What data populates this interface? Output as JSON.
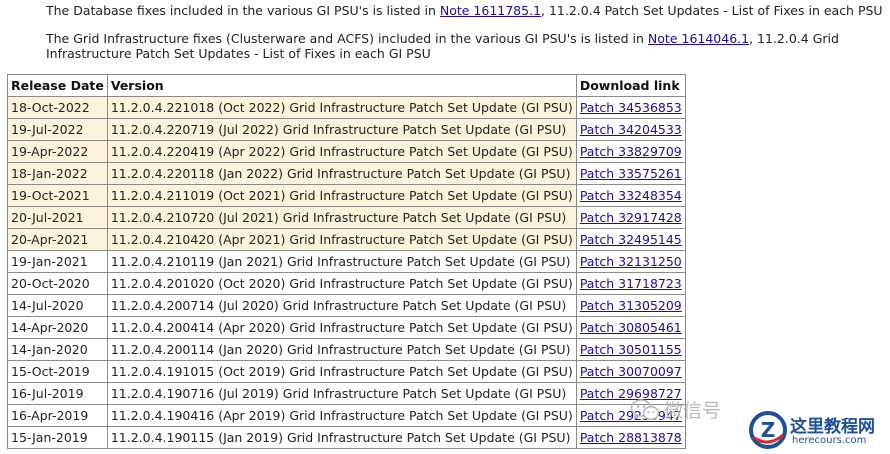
{
  "paragraphs": {
    "p1": {
      "prefix": "The Database fixes included in the various GI PSU's is listed in ",
      "link": "Note 1611785.1",
      "suffix": ", 11.2.0.4 Patch Set Updates - List of Fixes in each PSU"
    },
    "p2": {
      "prefix": "The Grid Infrastructure fixes (Clusterware and ACFS) included in the various GI PSU's is listed in ",
      "link": "Note 1614046.1",
      "suffix": ", 11.2.0.4 Grid Infrastructure Patch Set Updates - List of Fixes in each GI PSU"
    }
  },
  "table": {
    "headers": [
      "Release Date",
      "Version",
      "Download link"
    ],
    "highlight_color": "#fbf3da",
    "rows": [
      {
        "date": "18-Oct-2022",
        "version": "11.2.0.4.221018 (Oct 2022) Grid Infrastructure Patch Set Update (GI PSU)",
        "link": "Patch 34536853",
        "highlight": true
      },
      {
        "date": "19-Jul-2022",
        "version": "11.2.0.4.220719 (Jul 2022) Grid Infrastructure Patch Set Update (GI PSU)",
        "link": "Patch 34204533",
        "highlight": true
      },
      {
        "date": "19-Apr-2022",
        "version": "11.2.0.4.220419 (Apr 2022) Grid Infrastructure Patch Set Update (GI PSU)",
        "link": "Patch 33829709",
        "highlight": true
      },
      {
        "date": "18-Jan-2022",
        "version": "11.2.0.4.220118 (Jan 2022) Grid Infrastructure Patch Set Update (GI PSU)",
        "link": "Patch 33575261",
        "highlight": true
      },
      {
        "date": "19-Oct-2021",
        "version": "11.2.0.4.211019 (Oct 2021) Grid Infrastructure Patch Set Update (GI PSU)",
        "link": "Patch 33248354",
        "highlight": true
      },
      {
        "date": "20-Jul-2021",
        "version": "11.2.0.4.210720 (Jul 2021) Grid Infrastructure Patch Set Update (GI PSU)",
        "link": "Patch 32917428",
        "highlight": true
      },
      {
        "date": "20-Apr-2021",
        "version": "11.2.0.4.210420 (Apr 2021) Grid Infrastructure Patch Set Update (GI PSU)",
        "link": "Patch 32495145",
        "highlight": true
      },
      {
        "date": "19-Jan-2021",
        "version": "11.2.0.4.210119 (Jan 2021) Grid Infrastructure Patch Set Update (GI PSU)",
        "link": "Patch 32131250",
        "highlight": false
      },
      {
        "date": "20-Oct-2020",
        "version": "11.2.0.4.201020 (Oct 2020) Grid Infrastructure Patch Set Update (GI PSU)",
        "link": "Patch 31718723",
        "highlight": false
      },
      {
        "date": "14-Jul-2020",
        "version": "11.2.0.4.200714 (Jul 2020) Grid Infrastructure Patch Set Update (GI PSU)",
        "link": "Patch 31305209",
        "highlight": false
      },
      {
        "date": "14-Apr-2020",
        "version": "11.2.0.4.200414 (Apr 2020) Grid Infrastructure Patch Set Update (GI PSU)",
        "link": "Patch 30805461",
        "highlight": false
      },
      {
        "date": "14-Jan-2020",
        "version": "11.2.0.4.200114 (Jan 2020) Grid Infrastructure Patch Set Update (GI PSU)",
        "link": "Patch 30501155",
        "highlight": false
      },
      {
        "date": "15-Oct-2019",
        "version": "11.2.0.4.191015 (Oct 2019) Grid Infrastructure Patch Set Update (GI PSU)",
        "link": "Patch 30070097",
        "highlight": false
      },
      {
        "date": "16-Jul-2019",
        "version": "11.2.0.4.190716 (Jul 2019) Grid Infrastructure Patch Set Update (GI PSU)",
        "link": "Patch 29698727",
        "highlight": false
      },
      {
        "date": "16-Apr-2019",
        "version": "11.2.0.4.190416 (Apr 2019) Grid Infrastructure Patch Set Update (GI PSU)",
        "link": "Patch 29255947",
        "highlight": false
      },
      {
        "date": "15-Jan-2019",
        "version": "11.2.0.4.190115 (Jan 2019) Grid Infrastructure Patch Set Update (GI PSU)",
        "link": "Patch 28813878",
        "highlight": false
      }
    ]
  },
  "watermark": {
    "icon": "wechat-icon",
    "text": "微信号"
  },
  "site_logo": {
    "badge_letter": "Z",
    "name": "这里教程网",
    "domain": "herecours.com",
    "brand_color": "#1d4f9e",
    "accent_color": "#d62828"
  }
}
